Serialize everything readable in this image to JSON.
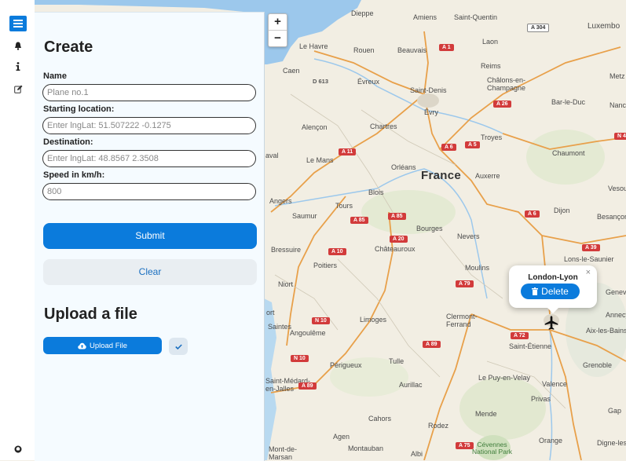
{
  "map": {
    "country": "France",
    "park": "Cévennes\nNational Park",
    "cities": [
      {
        "name": "Dieppe"
      },
      {
        "name": "Amiens"
      },
      {
        "name": "Saint-Quentin"
      },
      {
        "name": "Luxembo"
      },
      {
        "name": "Le Havre"
      },
      {
        "name": "Rouen"
      },
      {
        "name": "Beauvais"
      },
      {
        "name": "Laon"
      },
      {
        "name": "Caen"
      },
      {
        "name": "Évreux"
      },
      {
        "name": "Reims"
      },
      {
        "name": "Metz"
      },
      {
        "name": "Saint-Denis"
      },
      {
        "name": "Châlons-en-\nChampagne"
      },
      {
        "name": "Évry"
      },
      {
        "name": "Bar-le-Duc"
      },
      {
        "name": "Nanc"
      },
      {
        "name": "Alençon"
      },
      {
        "name": "Chartres"
      },
      {
        "name": "Troyes"
      },
      {
        "name": "Chaumont"
      },
      {
        "name": "aval"
      },
      {
        "name": "Le Mans"
      },
      {
        "name": "Orléans"
      },
      {
        "name": "Auxerre"
      },
      {
        "name": "Vesou"
      },
      {
        "name": "Blois"
      },
      {
        "name": "Angers"
      },
      {
        "name": "Tours"
      },
      {
        "name": "Dijon"
      },
      {
        "name": "Besançon"
      },
      {
        "name": "Saumur"
      },
      {
        "name": "Bourges"
      },
      {
        "name": "Nevers"
      },
      {
        "name": "Bressuire"
      },
      {
        "name": "Châteauroux"
      },
      {
        "name": "Lons-le-Saunier"
      },
      {
        "name": "Poitiers"
      },
      {
        "name": "Moulins"
      },
      {
        "name": "Niort"
      },
      {
        "name": "Genev"
      },
      {
        "name": "Limoges"
      },
      {
        "name": "Clermont-\nFerrand"
      },
      {
        "name": "Annecy"
      },
      {
        "name": "Saintes"
      },
      {
        "name": "Angoulême"
      },
      {
        "name": "Aix-les-Bains"
      },
      {
        "name": "Saint-Étienne"
      },
      {
        "name": "Tulle"
      },
      {
        "name": "Grenoble"
      },
      {
        "name": "Périgueux"
      },
      {
        "name": "Saint-Médard-\nen-Jalles"
      },
      {
        "name": "Aurillac"
      },
      {
        "name": "Le Puy-en-Velay"
      },
      {
        "name": "Valence"
      },
      {
        "name": "Privas"
      },
      {
        "name": "Cahors"
      },
      {
        "name": "Mende"
      },
      {
        "name": "Gap"
      },
      {
        "name": "Rodez"
      },
      {
        "name": "Agen"
      },
      {
        "name": "Orange"
      },
      {
        "name": "Digne-les"
      },
      {
        "name": "Mont-de-\nMarsan"
      },
      {
        "name": "Montauban"
      },
      {
        "name": "Albi"
      },
      {
        "name": "ort"
      }
    ],
    "roads": [
      {
        "ref": "A 1"
      },
      {
        "ref": "A 304",
        "style": "white"
      },
      {
        "ref": "D 613",
        "style": "blank"
      },
      {
        "ref": "A 26"
      },
      {
        "ref": "N 4"
      },
      {
        "ref": "A 11"
      },
      {
        "ref": "A 6"
      },
      {
        "ref": "A 5"
      },
      {
        "ref": "A 85"
      },
      {
        "ref": "A 85"
      },
      {
        "ref": "A 20"
      },
      {
        "ref": "A 10"
      },
      {
        "ref": "A 39"
      },
      {
        "ref": "A 6"
      },
      {
        "ref": "A 79"
      },
      {
        "ref": "N 10"
      },
      {
        "ref": "A 72"
      },
      {
        "ref": "A 89"
      },
      {
        "ref": "N 10"
      },
      {
        "ref": "A 89"
      },
      {
        "ref": "A 75"
      }
    ]
  },
  "zoom": {
    "in_label": "+",
    "out_label": "−"
  },
  "popup": {
    "title": "London-Lyon",
    "close_label": "×",
    "delete_label": "Delete"
  },
  "sidebar": {
    "create_heading": "Create",
    "fields": [
      {
        "label": "Name",
        "placeholder": "Plane no.1"
      },
      {
        "label": "Starting location:",
        "placeholder": "Enter lngLat: 51.507222 -0.1275"
      },
      {
        "label": "Destination:",
        "placeholder": "Enter lngLat: 48.8567 2.3508"
      },
      {
        "label": "Speed in km/h:",
        "placeholder": "800"
      }
    ],
    "submit_label": "Submit",
    "clear_label": "Clear",
    "upload_heading": "Upload a file",
    "upload_label": "Upload File"
  },
  "colors": {
    "accent": "#0b7bdc",
    "panel": "#f5fbff"
  }
}
